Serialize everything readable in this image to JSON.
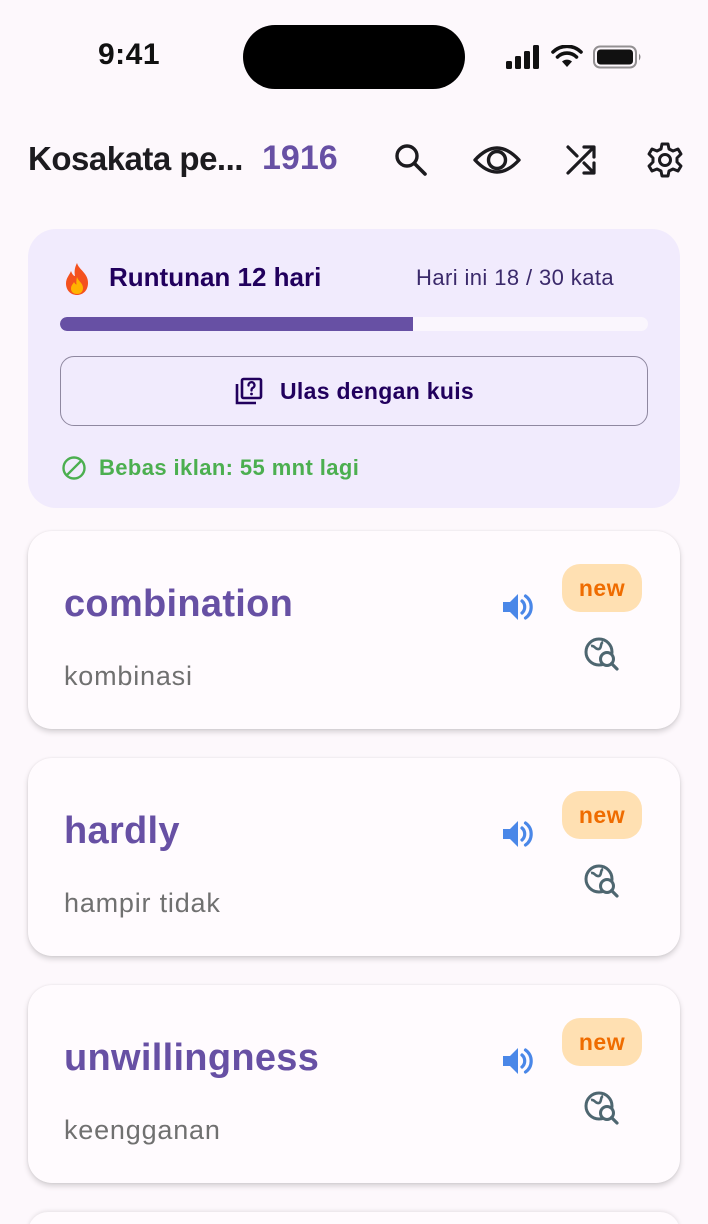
{
  "status_bar": {
    "time": "9:41"
  },
  "app_bar": {
    "title": "Kosakata pe...",
    "count": "1916",
    "icons": [
      "search-icon",
      "eye-icon",
      "shuffle-icon",
      "gear-icon"
    ]
  },
  "streak": {
    "title": "Runtunan 12 hari",
    "today_label": "Hari ini 18 / 30 kata",
    "progress_fraction": 0.6,
    "review_button_label": "Ulas dengan kuis",
    "adfree_label": "Bebas iklan: 55 mnt lagi"
  },
  "words": [
    {
      "term": "combination",
      "translation": "kombinasi",
      "badge": "new"
    },
    {
      "term": "hardly",
      "translation": "hampir tidak",
      "badge": "new"
    },
    {
      "term": "unwillingness",
      "translation": "keengganan",
      "badge": "new"
    }
  ],
  "colors": {
    "accent": "#6750a4",
    "streak_card_bg": "#f1ebfd",
    "badge_bg": "#ffe0b2",
    "badge_text": "#ef6c00",
    "speaker_blue": "#4a87e8",
    "adfree_green": "#4caf50"
  }
}
